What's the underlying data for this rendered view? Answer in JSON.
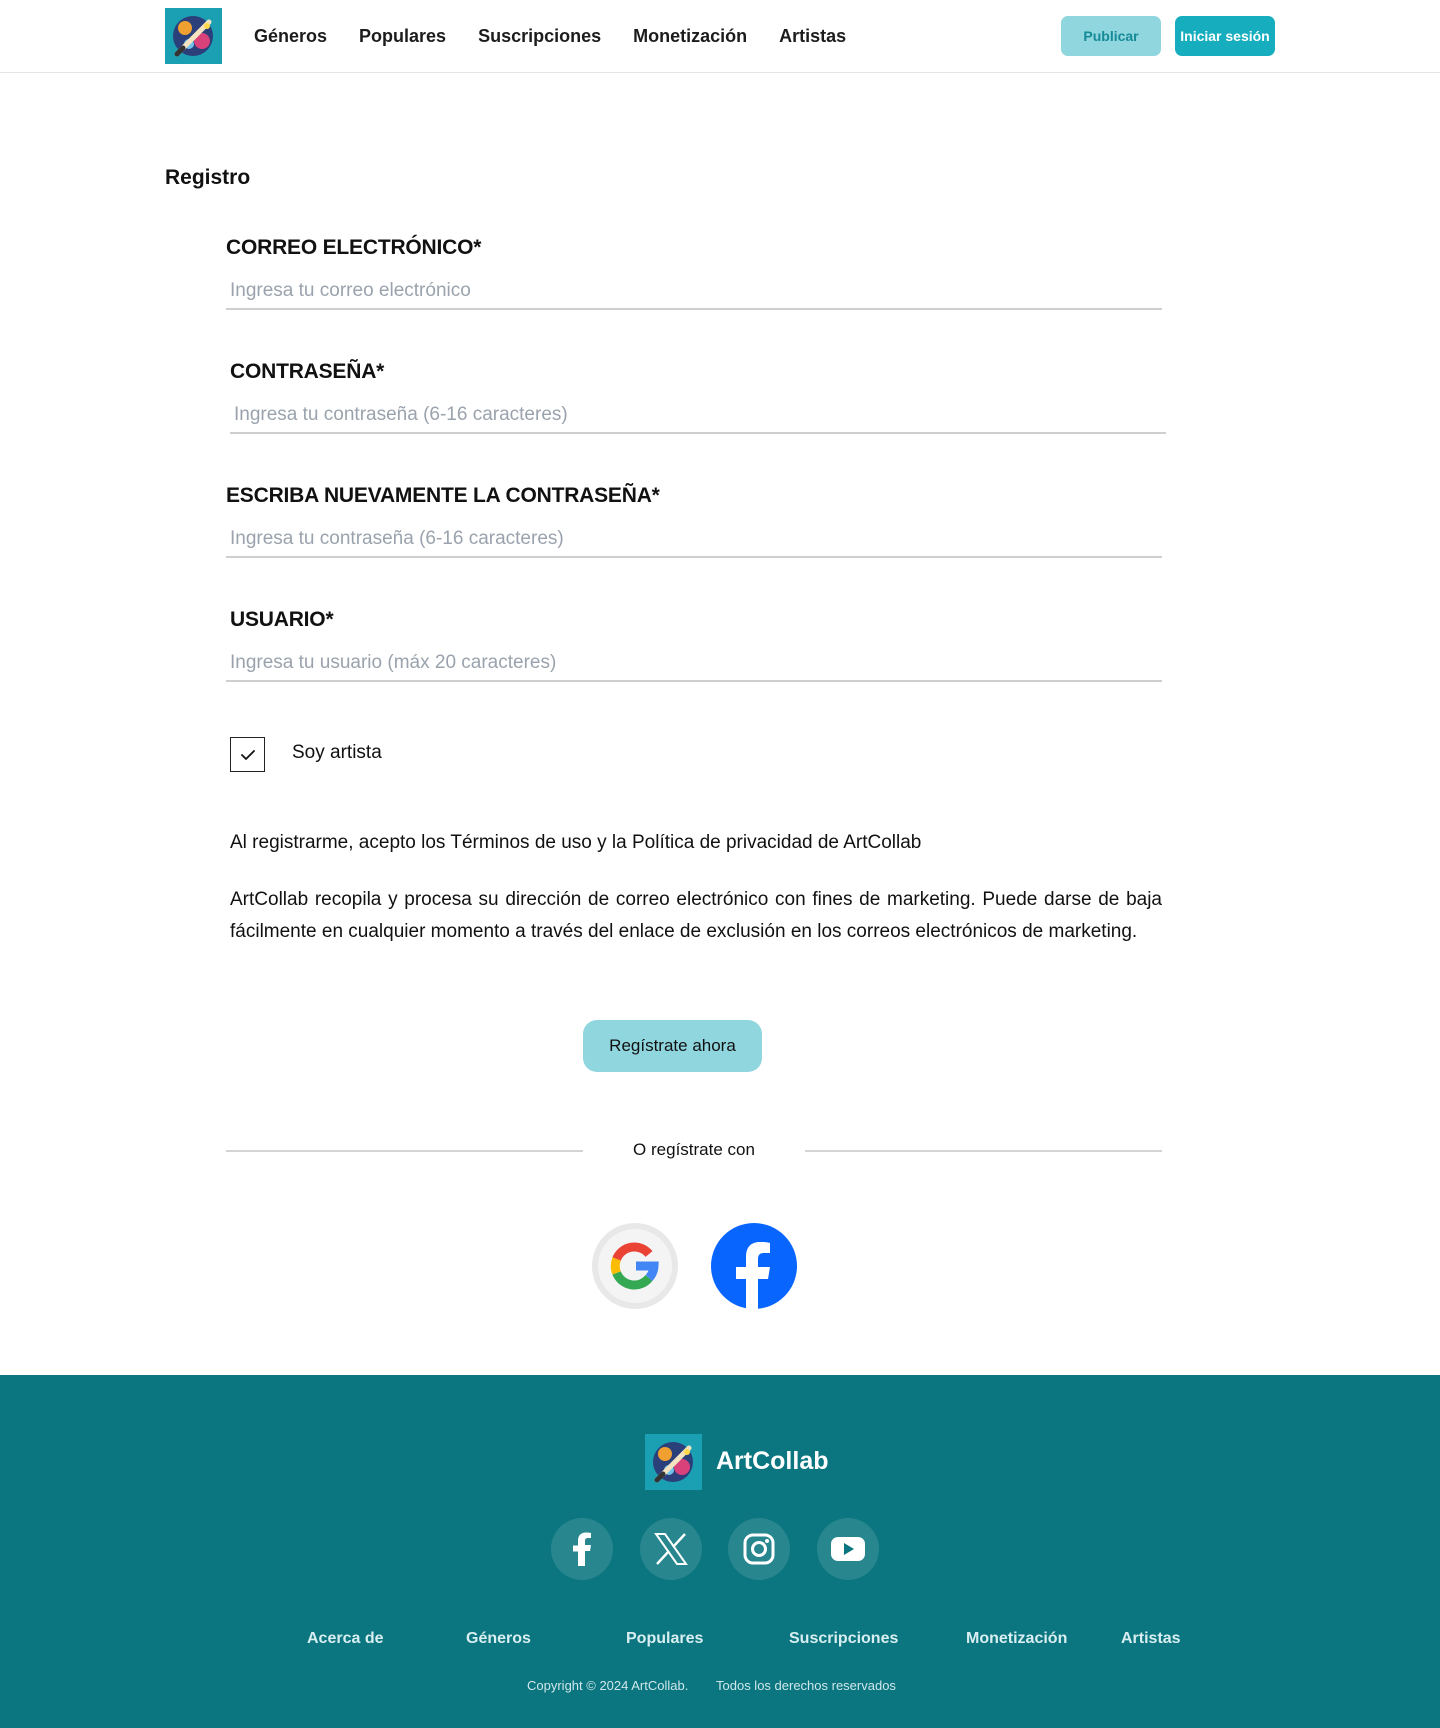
{
  "header": {
    "logo_alt": "ArtCollab",
    "nav": [
      "Géneros",
      "Populares",
      "Suscripciones",
      "Monetización",
      "Artistas"
    ],
    "publish_label": "Publicar",
    "login_label": "Iniciar sesión"
  },
  "form": {
    "title": "Registro",
    "fields": [
      {
        "label": "CORREO ELECTRÓNICO*",
        "placeholder": "Ingresa tu correo electrónico",
        "value": ""
      },
      {
        "label": "CONTRASEÑA*",
        "placeholder": "Ingresa tu contraseña (6-16 caracteres)",
        "value": ""
      },
      {
        "label": "ESCRIBA NUEVAMENTE LA CONTRASEÑA*",
        "placeholder": "Ingresa tu contraseña (6-16 caracteres)",
        "value": ""
      },
      {
        "label": "USUARIO*",
        "placeholder": "Ingresa tu usuario (máx 20 caracteres)",
        "value": ""
      }
    ],
    "artist_checkbox": {
      "label": "Soy artista",
      "checked": true
    },
    "terms": "Al registrarme, acepto los Términos de uso y la Política de privacidad de ArtCollab",
    "marketing": "ArtCollab recopila y procesa su dirección de correo electrónico con fines de marketing. Puede darse de baja fácilmente en cualquier momento a través del enlace de exclusión en los correos electrónicos de marketing.",
    "submit_label": "Regístrate ahora",
    "divider_text": "O regístrate con",
    "social_logins": [
      "google-icon",
      "facebook-icon"
    ]
  },
  "footer": {
    "brand": "ArtCollab",
    "social": [
      "facebook-icon",
      "x-icon",
      "instagram-icon",
      "youtube-icon"
    ],
    "links": [
      "Acerca de",
      "Géneros",
      "Populares",
      "Suscripciones",
      "Monetización",
      "Artistas"
    ],
    "copyright": "Copyright © 2024 ArtCollab.",
    "rights": "Todos los derechos reservados"
  },
  "colors": {
    "accent": "#16aebe",
    "accent_light": "#8fd6de",
    "footer_bg": "#0b7680",
    "facebook_blue": "#0866ff"
  }
}
